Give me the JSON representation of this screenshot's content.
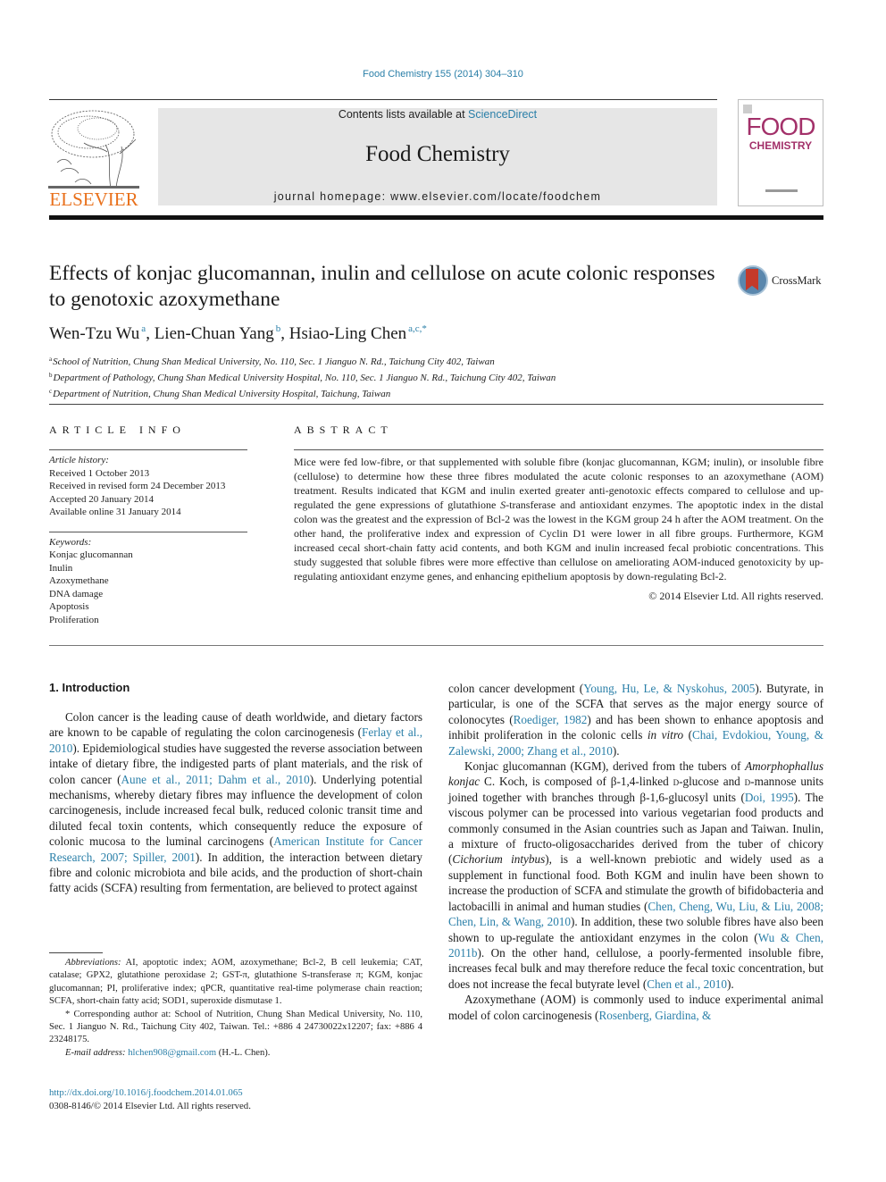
{
  "header": {
    "citation": "Food Chemistry 155 (2014) 304–310",
    "publisher_wordmark": "ELSEVIER",
    "contents_prefix": "Contents lists available at ",
    "contents_link": "ScienceDirect",
    "journal_title": "Food Chemistry",
    "homepage": "journal homepage: www.elsevier.com/locate/foodchem",
    "cover_word1": "FOOD",
    "cover_word2": "CHEMISTRY"
  },
  "article": {
    "title": "Effects of konjac glucomannan, inulin and cellulose on acute colonic responses to genotoxic azoxymethane",
    "crossmark_label": "CrossMark",
    "authors": [
      {
        "name": "Wen-Tzu Wu",
        "sup": "a"
      },
      {
        "name": "Lien-Chuan Yang",
        "sup": "b"
      },
      {
        "name": "Hsiao-Ling Chen",
        "sup": "a,c,*"
      }
    ],
    "author_separator": ", ",
    "affiliations": [
      {
        "sup": "a",
        "text": "School of Nutrition, Chung Shan Medical University, No. 110, Sec. 1 Jianguo N. Rd., Taichung City 402, Taiwan"
      },
      {
        "sup": "b",
        "text": "Department of Pathology, Chung Shan Medical University Hospital, No. 110, Sec. 1 Jianguo N. Rd., Taichung City 402, Taiwan"
      },
      {
        "sup": "c",
        "text": "Department of Nutrition, Chung Shan Medical University Hospital, Taichung, Taiwan"
      }
    ]
  },
  "article_info": {
    "heading": "ARTICLE INFO",
    "history_label": "Article history:",
    "history": [
      "Received 1 October 2013",
      "Received in revised form 24 December 2013",
      "Accepted 20 January 2014",
      "Available online 31 January 2014"
    ],
    "keywords_label": "Keywords:",
    "keywords": [
      "Konjac glucomannan",
      "Inulin",
      "Azoxymethane",
      "DNA damage",
      "Apoptosis",
      "Proliferation"
    ]
  },
  "abstract": {
    "heading": "ABSTRACT",
    "text_1": "Mice were fed low-fibre, or that supplemented with soluble fibre (konjac glucomannan, KGM; inulin), or insoluble fibre (cellulose) to determine how these three fibres modulated the acute colonic responses to an azoxymethane (AOM) treatment. Results indicated that KGM and inulin exerted greater anti-genotoxic effects compared to cellulose and up-regulated the gene expressions of glutathione ",
    "text_italic": "S",
    "text_2": "-transferase and antioxidant enzymes. The apoptotic index in the distal colon was the greatest and the expression of Bcl-2 was the lowest in the KGM group 24 h after the AOM treatment. On the other hand, the proliferative index and expression of Cyclin D1 were lower in all fibre groups. Furthermore, KGM increased cecal short-chain fatty acid contents, and both KGM and inulin increased fecal probiotic concentrations. This study suggested that soluble fibres were more effective than cellulose on ameliorating AOM-induced genotoxicity by up-regulating antioxidant enzyme genes, and enhancing epithelium apoptosis by down-regulating Bcl-2.",
    "copyright": "© 2014 Elsevier Ltd. All rights reserved."
  },
  "introduction": {
    "heading": "1. Introduction",
    "p1": [
      {
        "t": "Colon cancer is the leading cause of death worldwide, and dietary factors are known to be capable of regulating the colon car­cinogenesis ("
      },
      {
        "t": "Ferlay et al., 2010",
        "link": true
      },
      {
        "t": "). Epidemiological studies have sug­gested the reverse association between intake of dietary fibre, the indigested parts of plant materials, and the risk of colon cancer ("
      },
      {
        "t": "Aune et al., 2011; Dahm et al., 2010",
        "link": true
      },
      {
        "t": "). Underlying potential mech­anisms, whereby dietary fibres may influence the development of colon carcinogenesis, include increased fecal bulk, reduced colonic transit time and diluted fecal toxin contents, which consequently reduce the exposure of colonic mucosa to the luminal carcinogens ("
      },
      {
        "t": "American Institute for Cancer Research, 2007; Spiller, 2001",
        "link": true
      },
      {
        "t": "). In addition, the interaction between dietary fibre and colonic micro­biota and bile acids, and the production of short-chain fatty acids (SCFA) resulting from fermentation, are believed to protect against colon cancer development ("
      },
      {
        "t": "Young, Hu, Le, & Nyskohus, 2005",
        "link": true
      },
      {
        "t": "). Butyrate, in particular, is one of the SCFA that serves as the major energy source of colonocytes ("
      },
      {
        "t": "Roediger, 1982",
        "link": true
      },
      {
        "t": ") and has been shown to enhance apoptosis and inhibit proliferation in the colonic cells "
      },
      {
        "t": "in vitro",
        "italic": true
      },
      {
        "t": " ("
      },
      {
        "t": "Chai, Evdokiou, Young, & Zalewski, 2000; Zhang et al., 2010",
        "link": true
      },
      {
        "t": ")."
      }
    ],
    "p2": [
      {
        "t": "Konjac glucomannan (KGM), derived from the tubers of "
      },
      {
        "t": "Amor­phophallus konjac",
        "italic": true
      },
      {
        "t": " C. Koch, is composed of β-1,4-linked "
      },
      {
        "t": "d",
        "smallcaps": true
      },
      {
        "t": "-glucose and "
      },
      {
        "t": "d",
        "smallcaps": true
      },
      {
        "t": "-mannose units joined together with branches through β-1,6-glucosyl units ("
      },
      {
        "t": "Doi, 1995",
        "link": true
      },
      {
        "t": "). The viscous polymer can be processed into various vegetarian food products and commonly consumed in the Asian countries such as Japan and Taiwan. Inulin, a mixture of fructo-oligosaccharides derived from the tuber of chic­ory ("
      },
      {
        "t": "Cichorium intybus",
        "italic": true
      },
      {
        "t": "), is a well-known prebiotic and widely used as a supplement in functional food. Both KGM and inulin have been shown to increase the production of SCFA and stimulate the growth of bifidobacteria and lactobacilli in animal and human studies ("
      },
      {
        "t": "Chen, Cheng, Wu, Liu, & Liu, 2008; Chen, Lin, & Wang, 2010",
        "link": true
      },
      {
        "t": "). In addition, these two soluble fibres have also been shown to up-regulate the antioxidant enzymes in the colon ("
      },
      {
        "t": "Wu & Chen, 2011b",
        "link": true
      },
      {
        "t": "). On the other hand, cellulose, a poorly-fermented insoluble fibre, increases fecal bulk and may therefore reduce the fecal toxic concentration, but does not increase the fecal butyrate level ("
      },
      {
        "t": "Chen et al., 2010",
        "link": true
      },
      {
        "t": ")."
      }
    ],
    "p3": [
      {
        "t": "Azoxymethane (AOM) is commonly used to induce experimen­tal animal model of colon carcinogenesis ("
      },
      {
        "t": "Rosenberg, Giardina, &",
        "link": true
      }
    ]
  },
  "footnotes": {
    "abbrev_label": "Abbreviations:",
    "abbrev_text": " AI, apoptotic index; AOM, azoxymethane; Bcl-2, B cell leukemia; CAT, catalase; GPX2, glutathione peroxidase 2; GST-π, glutathione S-transferase π; KGM, konjac glucomannan; PI, proliferative index; qPCR, quantitative real-time polymerase chain reaction; SCFA, short-chain fatty acid; SOD1, superoxide dismu­tase 1.",
    "corresponding": "* Corresponding author at: School of Nutrition, Chung Shan Medical University, No. 110, Sec. 1 Jianguo N. Rd., Taichung City 402, Taiwan. Tel.: +886 4 24730022x12207; fax: +886 4 23248175.",
    "email_label": "E-mail address:",
    "email": "hlchen908@gmail.com",
    "email_suffix": " (H.-L. Chen)."
  },
  "doi": {
    "url": "http://dx.doi.org/10.1016/j.foodchem.2014.01.065",
    "issn_line": "0308-8146/© 2014 Elsevier Ltd. All rights reserved."
  },
  "colors": {
    "link": "#2a7fa8",
    "elsevier_orange": "#e9711c",
    "cover_magenta": "#a3316a",
    "banner_gray": "#e6e6e6"
  }
}
